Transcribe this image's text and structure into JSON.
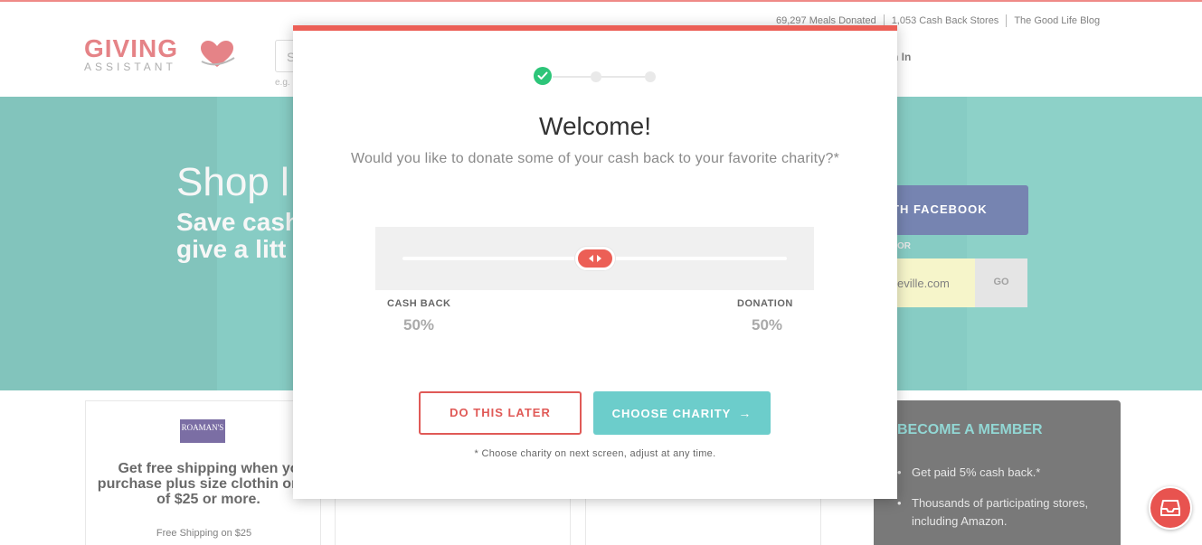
{
  "top_links": [
    "69,297 Meals Donated",
    "1,053 Cash Back Stores",
    "The Good Life Blog"
  ],
  "logo": {
    "line1": "GIVING",
    "line2": "ASSISTANT"
  },
  "search": {
    "placeholder_fragment": "S",
    "example_fragment": "e.g."
  },
  "signin_fragment": "n In",
  "hero": {
    "title_fragment": "Shop l",
    "subtitle_fragment": "Save cash give a litt",
    "facebook_fragment": "TH FACEBOOK",
    "or": "OR",
    "email_fragment": "eville.com",
    "go": "GO"
  },
  "cards": [
    {
      "brand": "ROAMAN'S",
      "description": "Get free shipping when yo purchase plus size clothin order of $25 or more.",
      "footer": "Free Shipping on $25"
    }
  ],
  "member": {
    "title": "BECOME A MEMBER",
    "items": [
      "Get paid 5% cash back.*",
      "Thousands of participating stores, including Amazon."
    ]
  },
  "modal": {
    "accent": "#ec5f56",
    "title": "Welcome!",
    "question": "Would you like to donate some of your cash back to your favorite charity?*",
    "slider": {
      "cashback_fraction": 0.5
    },
    "cashback_label": "CASH BACK",
    "cashback_value": "50%",
    "donation_label": "DONATION",
    "donation_value": "50%",
    "later_button": "DO THIS LATER",
    "charity_button": "CHOOSE CHARITY",
    "footnote": "* Choose charity on next screen, adjust at any time."
  },
  "icons": [
    "check-icon",
    "heart-logo-icon",
    "inbox-icon",
    "arrow-right-icon",
    "left-right-arrows-icon"
  ]
}
